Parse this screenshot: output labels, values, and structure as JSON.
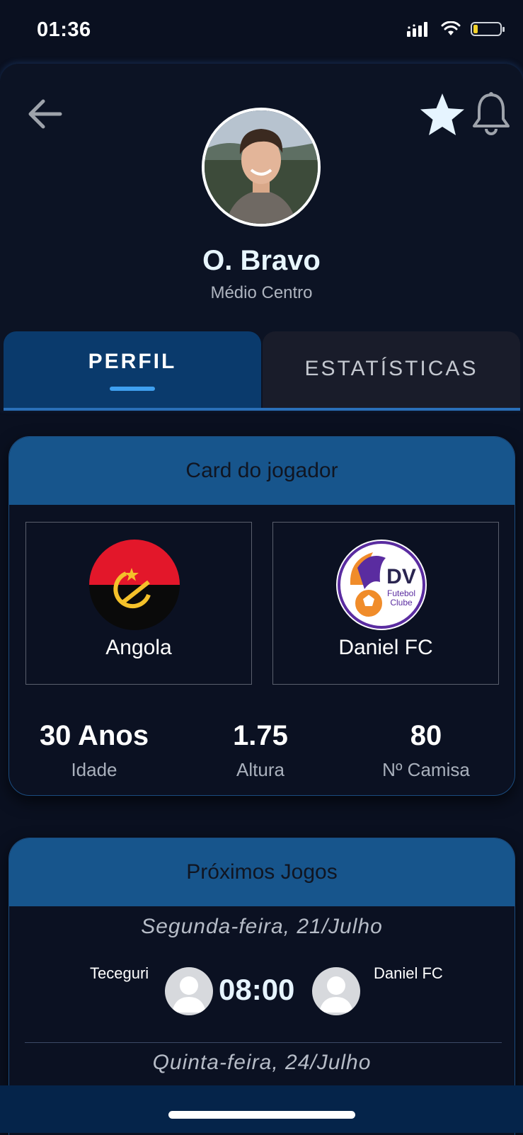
{
  "status_bar": {
    "time": "01:36"
  },
  "header": {
    "player_name": "O. Bravo",
    "player_position": "Médio Centro",
    "favorite_color": "#e6f4ff"
  },
  "tabs": [
    {
      "label": "PERFIL",
      "active": true
    },
    {
      "label": "ESTATÍSTICAS",
      "active": false
    }
  ],
  "player_card": {
    "title": "Card do jogador",
    "country": "Angola",
    "club": "Daniel FC",
    "club_logo_text": [
      "DV",
      "Futebol",
      "Clube"
    ],
    "stats": [
      {
        "value": "30 Anos",
        "label": "Idade"
      },
      {
        "value": "1.75",
        "label": "Altura"
      },
      {
        "value": "80",
        "label": "Nº Camisa"
      }
    ]
  },
  "games": {
    "title": "Próximos Jogos",
    "days": [
      {
        "date": "Segunda-feira, 21/Julho",
        "home": "Teceguri",
        "time": "08:00",
        "away": "Daniel FC"
      },
      {
        "date": "Quinta-feira, 24/Julho"
      }
    ]
  },
  "colors": {
    "background": "#0a1020",
    "tab_active": "#0a3a6c",
    "card_header": "#17558c",
    "accent": "#3fa0f0"
  }
}
